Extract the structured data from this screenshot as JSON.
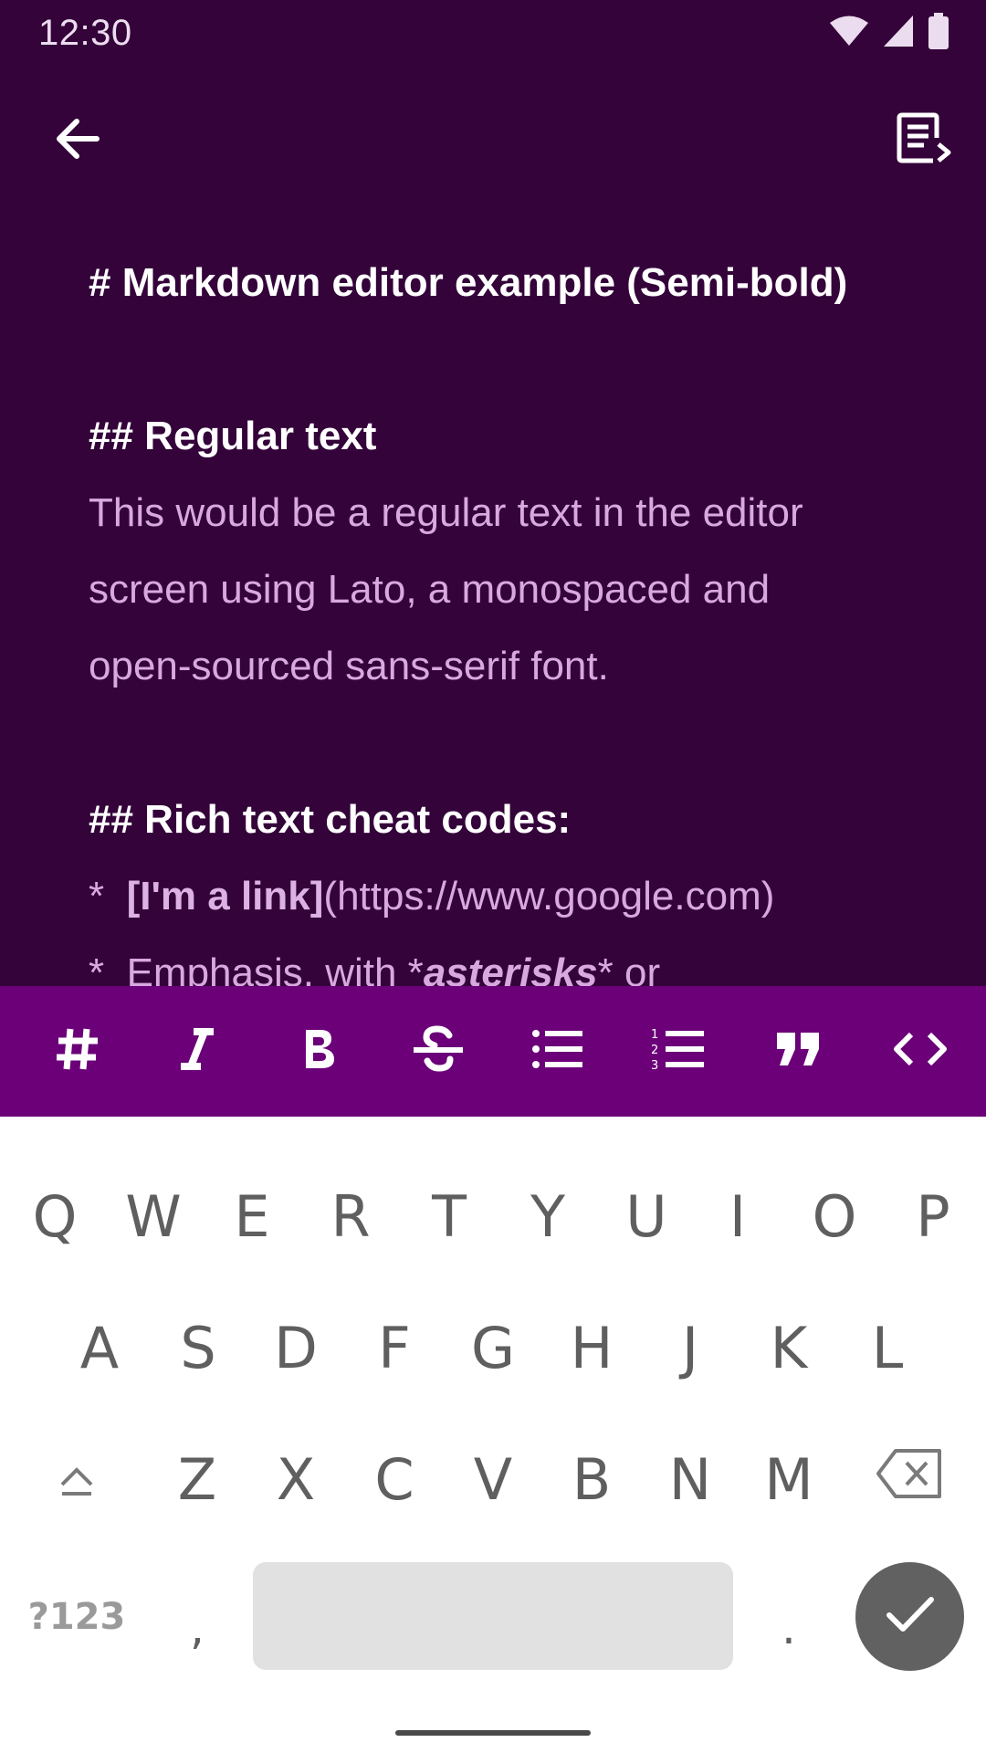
{
  "status": {
    "time": "12:30"
  },
  "editor": {
    "lines": [
      {
        "text": "# Markdown editor example (Semi-bold)"
      },
      {
        "text": "## Regular text"
      },
      {
        "text": "This would be a regular text in the editor"
      },
      {
        "text": "screen using Lato, a monospaced and"
      },
      {
        "text": "open-sourced sans-serif font."
      },
      {
        "text": "## Rich text cheat codes:"
      },
      {
        "bullet": "*",
        "link_text": "[I'm a link]",
        "link_url": "(https://www.google.com)"
      },
      {
        "bullet": "*",
        "prefix": "Emphasis, with *",
        "emph": "asterisks",
        "suffix": "* or"
      }
    ]
  },
  "toolbar": {
    "buttons": [
      "heading",
      "italic",
      "bold",
      "strikethrough",
      "bulleted-list",
      "numbered-list",
      "quote",
      "code"
    ]
  },
  "keyboard": {
    "row1": [
      "Q",
      "W",
      "E",
      "R",
      "T",
      "Y",
      "U",
      "I",
      "O",
      "P"
    ],
    "row2": [
      "A",
      "S",
      "D",
      "F",
      "G",
      "H",
      "J",
      "K",
      "L"
    ],
    "row3": [
      "Z",
      "X",
      "C",
      "V",
      "B",
      "N",
      "M"
    ],
    "symbols": "?123",
    "comma": ",",
    "period": "."
  },
  "colors": {
    "background": "#34033a",
    "toolbar": "#6b0079",
    "heading_text": "#ffffff",
    "body_text": "#d8a8e0",
    "keyboard": "#ffffff",
    "enter_key": "#616161"
  },
  "icons": {
    "back": "arrow-left-icon",
    "preview": "document-preview-icon",
    "wifi": "wifi-icon",
    "signal": "signal-icon",
    "battery": "battery-icon",
    "shift": "shift-icon",
    "backspace": "backspace-icon",
    "enter": "checkmark-icon"
  }
}
